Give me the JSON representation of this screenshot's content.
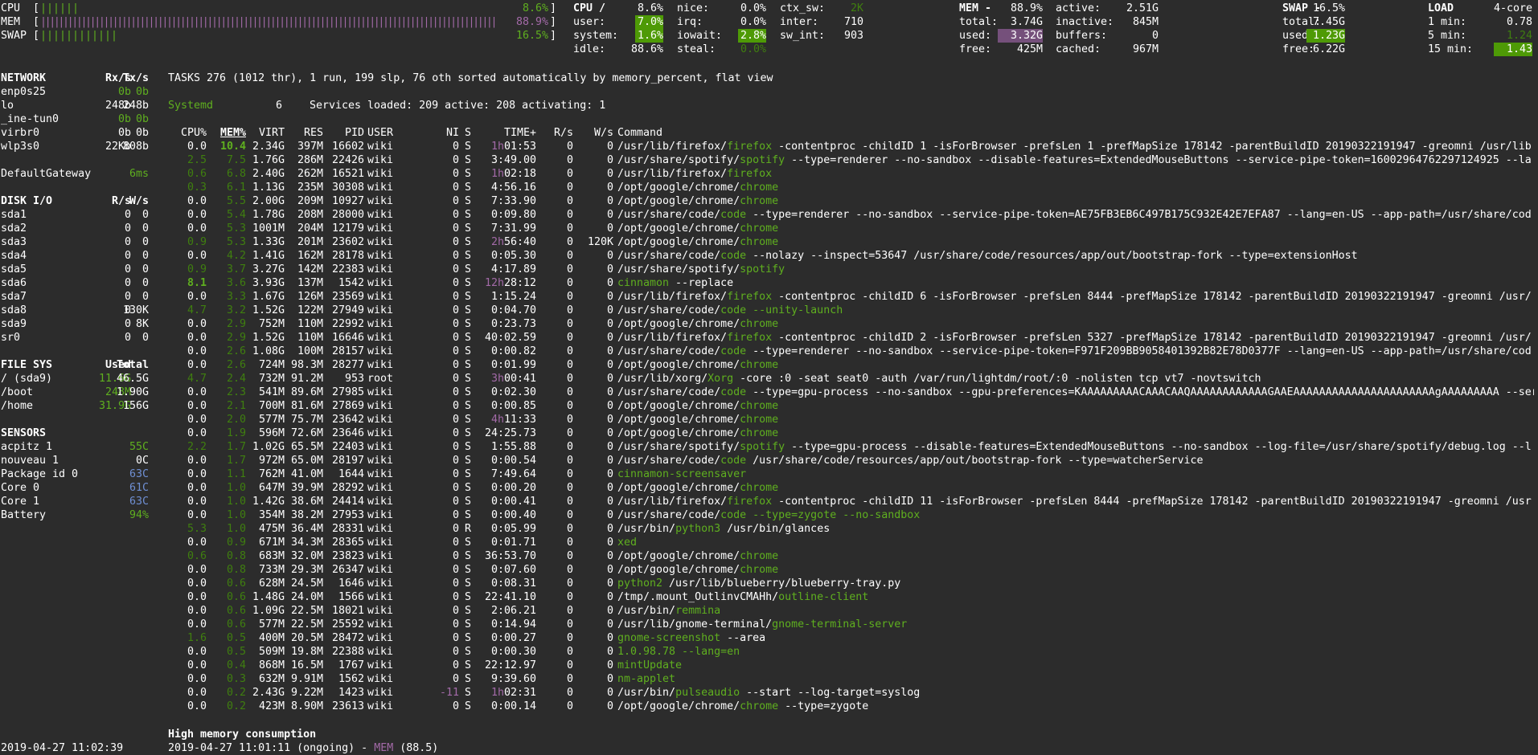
{
  "top": {
    "cpu_label": "CPU",
    "cpu_bar": "||||||",
    "cpu_pct": "8.6%",
    "mem_label": "MEM",
    "mem_bar": "|||||||||||||||||||||||||||||||||||||||||||||||||||||||||||||||||||||||||||||||||||||||||||||||||||||",
    "mem_pct": "88.9%",
    "swap_label": "SWAP",
    "swap_bar": "||||||||||||",
    "swap_pct": "16.5%",
    "cpu_block": {
      "title": "CPU /",
      "total": "8.6%",
      "rows": [
        [
          "user:",
          "7.0%"
        ],
        [
          "system:",
          "1.6%"
        ],
        [
          "idle:",
          "88.6%"
        ]
      ],
      "mid": [
        [
          "nice:",
          "0.0%"
        ],
        [
          "irq:",
          "0.0%"
        ],
        [
          "iowait:",
          "2.8%"
        ],
        [
          "steal:",
          "0.0%"
        ]
      ],
      "right": [
        [
          "ctx_sw:",
          "2K"
        ],
        [
          "inter:",
          "710"
        ],
        [
          "sw_int:",
          "903"
        ]
      ]
    },
    "mem_block": {
      "title": "MEM -",
      "pct": "88.9%",
      "rows": [
        [
          "total:",
          "3.74G"
        ],
        [
          "used:",
          "3.32G"
        ],
        [
          "free:",
          "425M"
        ]
      ],
      "right": [
        [
          "active:",
          "2.51G"
        ],
        [
          "inactive:",
          "845M"
        ],
        [
          "buffers:",
          "0"
        ],
        [
          "cached:",
          "967M"
        ]
      ]
    },
    "swap_block": {
      "title": "SWAP -",
      "pct": "16.5%",
      "rows": [
        [
          "total:",
          "7.45G"
        ],
        [
          "used:",
          "1.23G"
        ],
        [
          "free:",
          "6.22G"
        ]
      ]
    },
    "load_block": {
      "title": "LOAD",
      "cores": "4-core",
      "rows": [
        [
          "1 min:",
          "0.78"
        ],
        [
          "5 min:",
          "1.24"
        ],
        [
          "15 min:",
          "1.43"
        ]
      ]
    }
  },
  "network": {
    "header": [
      "NETWORK",
      "Rx/s",
      "Tx/s"
    ],
    "rows": [
      [
        "enp0s25",
        "0b",
        "0b"
      ],
      [
        "lo",
        "248b",
        "248b"
      ],
      [
        "_ine-tun0",
        "0b",
        "0b"
      ],
      [
        "virbr0",
        "0b",
        "0b"
      ],
      [
        "wlp3s0",
        "22Kb",
        "808b"
      ]
    ],
    "gateway": [
      "DefaultGateway",
      "6ms"
    ]
  },
  "disk": {
    "header": [
      "DISK I/O",
      "R/s",
      "W/s"
    ],
    "rows": [
      [
        "sda1",
        "0",
        "0"
      ],
      [
        "sda2",
        "0",
        "0"
      ],
      [
        "sda3",
        "0",
        "0"
      ],
      [
        "sda4",
        "0",
        "0"
      ],
      [
        "sda5",
        "0",
        "0"
      ],
      [
        "sda6",
        "0",
        "0"
      ],
      [
        "sda7",
        "0",
        "0"
      ],
      [
        "sda8",
        "0",
        "130K"
      ],
      [
        "sda9",
        "0",
        "8K"
      ],
      [
        "sr0",
        "0",
        "0"
      ]
    ]
  },
  "fs": {
    "header": [
      "FILE SYS",
      "Used",
      "Total"
    ],
    "rows": [
      [
        "/ (sda9)",
        "11.6G",
        "46.5G"
      ],
      [
        "/boot",
        "248M",
        "1.90G"
      ],
      [
        "/home",
        "31.9G",
        "156G"
      ]
    ]
  },
  "sensors": {
    "header": "SENSORS",
    "rows": [
      [
        "acpitz 1",
        "55C"
      ],
      [
        "nouveau 1",
        "0C"
      ],
      [
        "Package id 0",
        "63C"
      ],
      [
        "Core 0",
        "61C"
      ],
      [
        "Core 1",
        "63C"
      ],
      [
        "Battery",
        "94%"
      ]
    ]
  },
  "tasks_line": "TASKS 276 (1012 thr), 1 run, 199 slp, 76 oth sorted automatically by memory_percent, flat view",
  "systemd": {
    "label": "Systemd",
    "count": "6",
    "services": "Services loaded: 209 active: 208 activating: 1"
  },
  "proc_header": [
    "CPU%",
    "MEM%",
    "VIRT",
    "RES",
    "PID",
    "USER",
    "NI",
    "S",
    "TIME+",
    "R/s",
    "W/s",
    "Command"
  ],
  "processes": [
    [
      "0.0",
      "10.4",
      "2.34G",
      "397M",
      "16602",
      "wiki",
      "0",
      "S",
      "1h01:53",
      "0",
      "0",
      "/usr/lib/firefox/",
      "firefox",
      " -contentproc -childID 1 -isForBrowser -prefsLen 1 -prefMapSize 178142 -parentBuildID 20190322191947 -greomni /usr/lib"
    ],
    [
      "2.5",
      "7.5",
      "1.76G",
      "286M",
      "22426",
      "wiki",
      "0",
      "S",
      "3:49.00",
      "0",
      "0",
      "/usr/share/spotify/",
      "spotify",
      " --type=renderer --no-sandbox --disable-features=ExtendedMouseButtons --service-pipe-token=16002964762297124925 --la"
    ],
    [
      "0.6",
      "6.8",
      "2.40G",
      "262M",
      "16521",
      "wiki",
      "0",
      "S",
      "1h02:18",
      "0",
      "0",
      "/usr/lib/firefox/",
      "firefox",
      ""
    ],
    [
      "0.3",
      "6.1",
      "1.13G",
      "235M",
      "30308",
      "wiki",
      "0",
      "S",
      "4:56.16",
      "0",
      "0",
      "/opt/google/chrome/",
      "chrome",
      ""
    ],
    [
      "0.0",
      "5.5",
      "2.00G",
      "209M",
      "10927",
      "wiki",
      "0",
      "S",
      "7:33.90",
      "0",
      "0",
      "/opt/google/chrome/",
      "chrome",
      ""
    ],
    [
      "0.0",
      "5.4",
      "1.78G",
      "208M",
      "28000",
      "wiki",
      "0",
      "S",
      "0:09.80",
      "0",
      "0",
      "/usr/share/code/",
      "code",
      " --type=renderer --no-sandbox --service-pipe-token=AE75FB3EB6C497B175C932E42E7EFA87 --lang=en-US --app-path=/usr/share/cod"
    ],
    [
      "0.0",
      "5.3",
      "1001M",
      "204M",
      "12179",
      "wiki",
      "0",
      "S",
      "7:31.99",
      "0",
      "0",
      "/opt/google/chrome/",
      "chrome",
      ""
    ],
    [
      "0.9",
      "5.3",
      "1.33G",
      "201M",
      "23602",
      "wiki",
      "0",
      "S",
      "2h56:40",
      "0",
      "120K",
      "/opt/google/chrome/",
      "chrome",
      ""
    ],
    [
      "0.0",
      "4.2",
      "1.41G",
      "162M",
      "28178",
      "wiki",
      "0",
      "S",
      "0:05.30",
      "0",
      "0",
      "/usr/share/code/",
      "code",
      " --nolazy --inspect=53647 /usr/share/code/resources/app/out/bootstrap-fork --type=extensionHost"
    ],
    [
      "0.9",
      "3.7",
      "3.27G",
      "142M",
      "22383",
      "wiki",
      "0",
      "S",
      "4:17.89",
      "0",
      "0",
      "/usr/share/spotify/",
      "spotify",
      ""
    ],
    [
      "8.1",
      "3.6",
      "3.93G",
      "137M",
      "1542",
      "wiki",
      "0",
      "S",
      "12h28:12",
      "0",
      "0",
      "",
      "cinnamon",
      " --replace"
    ],
    [
      "0.0",
      "3.3",
      "1.67G",
      "126M",
      "23569",
      "wiki",
      "0",
      "S",
      "1:15.24",
      "0",
      "0",
      "/usr/lib/firefox/",
      "firefox",
      " -contentproc -childID 6 -isForBrowser -prefsLen 8444 -prefMapSize 178142 -parentBuildID 20190322191947 -greomni /usr/"
    ],
    [
      "4.7",
      "3.2",
      "1.52G",
      "122M",
      "27949",
      "wiki",
      "0",
      "S",
      "0:04.70",
      "0",
      "0",
      "/usr/share/code/",
      "code",
      " --unity-launch"
    ],
    [
      "0.0",
      "2.9",
      "752M",
      "110M",
      "22992",
      "wiki",
      "0",
      "S",
      "0:23.73",
      "0",
      "0",
      "/opt/google/chrome/",
      "chrome",
      ""
    ],
    [
      "0.0",
      "2.9",
      "1.52G",
      "110M",
      "16646",
      "wiki",
      "0",
      "S",
      "40:02.59",
      "0",
      "0",
      "/usr/lib/firefox/",
      "firefox",
      " -contentproc -childID 2 -isForBrowser -prefsLen 5327 -prefMapSize 178142 -parentBuildID 20190322191947 -greomni /usr/"
    ],
    [
      "0.0",
      "2.6",
      "1.08G",
      "100M",
      "28157",
      "wiki",
      "0",
      "S",
      "0:00.82",
      "0",
      "0",
      "/usr/share/code/",
      "code",
      " --type=renderer --no-sandbox --service-pipe-token=F971F209BB9058401392B82E78D0377F --lang=en-US --app-path=/usr/share/cod"
    ],
    [
      "0.0",
      "2.6",
      "724M",
      "98.3M",
      "28277",
      "wiki",
      "0",
      "S",
      "0:01.99",
      "0",
      "0",
      "/opt/google/chrome/",
      "chrome",
      ""
    ],
    [
      "4.7",
      "2.4",
      "732M",
      "91.2M",
      "953",
      "root",
      "0",
      "S",
      "3h00:41",
      "0",
      "0",
      "/usr/lib/xorg/",
      "Xorg",
      " -core :0 -seat seat0 -auth /var/run/lightdm/root/:0 -nolisten tcp vt7 -novtswitch"
    ],
    [
      "0.0",
      "2.3",
      "541M",
      "89.6M",
      "27985",
      "wiki",
      "0",
      "S",
      "0:02.30",
      "0",
      "0",
      "/usr/share/code/",
      "code",
      " --type=gpu-process --no-sandbox --gpu-preferences=KAAAAAAAAACAAACAAQAAAAAAAAAAAAGAAEAAAAAAAAAAAAAAAAAAAAAAgAAAAAAAAA --serv"
    ],
    [
      "0.0",
      "2.1",
      "700M",
      "81.6M",
      "27869",
      "wiki",
      "0",
      "S",
      "0:00.85",
      "0",
      "0",
      "/opt/google/chrome/",
      "chrome",
      ""
    ],
    [
      "0.0",
      "2.0",
      "577M",
      "75.7M",
      "23642",
      "wiki",
      "0",
      "S",
      "4h11:33",
      "0",
      "0",
      "/opt/google/chrome/",
      "chrome",
      ""
    ],
    [
      "0.0",
      "1.9",
      "596M",
      "72.6M",
      "23646",
      "wiki",
      "0",
      "S",
      "24:25.73",
      "0",
      "0",
      "/opt/google/chrome/",
      "chrome",
      ""
    ],
    [
      "2.2",
      "1.7",
      "1.02G",
      "65.5M",
      "22403",
      "wiki",
      "0",
      "S",
      "1:55.88",
      "0",
      "0",
      "/usr/share/spotify/",
      "spotify",
      " --type=gpu-process --disable-features=ExtendedMouseButtons --no-sandbox --log-file=/usr/share/spotify/debug.log --l"
    ],
    [
      "0.0",
      "1.7",
      "972M",
      "65.0M",
      "28197",
      "wiki",
      "0",
      "S",
      "0:00.54",
      "0",
      "0",
      "/usr/share/code/",
      "code",
      " /usr/share/code/resources/app/out/bootstrap-fork --type=watcherService"
    ],
    [
      "0.0",
      "1.1",
      "762M",
      "41.0M",
      "1644",
      "wiki",
      "0",
      "S",
      "7:49.64",
      "0",
      "0",
      "",
      "cinnamon-screensaver",
      ""
    ],
    [
      "0.0",
      "1.0",
      "647M",
      "39.9M",
      "28292",
      "wiki",
      "0",
      "S",
      "0:00.20",
      "0",
      "0",
      "/opt/google/chrome/",
      "chrome",
      ""
    ],
    [
      "0.0",
      "1.0",
      "1.42G",
      "38.6M",
      "24414",
      "wiki",
      "0",
      "S",
      "0:00.41",
      "0",
      "0",
      "/usr/lib/firefox/",
      "firefox",
      " -contentproc -childID 11 -isForBrowser -prefsLen 8444 -prefMapSize 178142 -parentBuildID 20190322191947 -greomni /usr"
    ],
    [
      "0.0",
      "1.0",
      "354M",
      "38.2M",
      "27953",
      "wiki",
      "0",
      "S",
      "0:00.40",
      "0",
      "0",
      "/usr/share/code/",
      "code",
      " --type=zygote --no-sandbox"
    ],
    [
      "5.3",
      "1.0",
      "475M",
      "36.4M",
      "28331",
      "wiki",
      "0",
      "R",
      "0:05.99",
      "0",
      "0",
      "/usr/bin/",
      "python3",
      " /usr/bin/glances"
    ],
    [
      "0.0",
      "0.9",
      "671M",
      "34.3M",
      "28365",
      "wiki",
      "0",
      "S",
      "0:01.71",
      "0",
      "0",
      "",
      "xed",
      ""
    ],
    [
      "0.6",
      "0.8",
      "683M",
      "32.0M",
      "23823",
      "wiki",
      "0",
      "S",
      "36:53.70",
      "0",
      "0",
      "/opt/google/chrome/",
      "chrome",
      ""
    ],
    [
      "0.0",
      "0.8",
      "733M",
      "29.3M",
      "26347",
      "wiki",
      "0",
      "S",
      "0:07.60",
      "0",
      "0",
      "/opt/google/chrome/",
      "chrome",
      ""
    ],
    [
      "0.0",
      "0.6",
      "628M",
      "24.5M",
      "1646",
      "wiki",
      "0",
      "S",
      "0:08.31",
      "0",
      "0",
      "",
      "python2",
      " /usr/lib/blueberry/blueberry-tray.py"
    ],
    [
      "0.0",
      "0.6",
      "1.48G",
      "24.0M",
      "1566",
      "wiki",
      "0",
      "S",
      "22:41.10",
      "0",
      "0",
      "/tmp/.mount_OutlinvCMAHh/",
      "outline-client",
      ""
    ],
    [
      "0.0",
      "0.6",
      "1.09G",
      "22.5M",
      "18021",
      "wiki",
      "0",
      "S",
      "2:06.21",
      "0",
      "0",
      "/usr/bin/",
      "remmina",
      ""
    ],
    [
      "0.0",
      "0.6",
      "577M",
      "22.5M",
      "25592",
      "wiki",
      "0",
      "S",
      "0:14.94",
      "0",
      "0",
      "/usr/lib/gnome-terminal/",
      "gnome-terminal-server",
      ""
    ],
    [
      "1.6",
      "0.5",
      "400M",
      "20.5M",
      "28472",
      "wiki",
      "0",
      "S",
      "0:00.27",
      "0",
      "0",
      "",
      "gnome-screenshot",
      " --area"
    ],
    [
      "0.0",
      "0.5",
      "509M",
      "19.8M",
      "22388",
      "wiki",
      "0",
      "S",
      "0:00.30",
      "0",
      "0",
      "",
      "1.0.98.78 --lang=en",
      ""
    ],
    [
      "0.0",
      "0.4",
      "868M",
      "16.5M",
      "1767",
      "wiki",
      "0",
      "S",
      "22:12.97",
      "0",
      "0",
      "",
      "mintUpdate",
      ""
    ],
    [
      "0.0",
      "0.3",
      "632M",
      "9.91M",
      "1562",
      "wiki",
      "0",
      "S",
      "9:39.60",
      "0",
      "0",
      "",
      "nm-applet",
      ""
    ],
    [
      "0.0",
      "0.2",
      "2.43G",
      "9.22M",
      "1423",
      "wiki",
      "-11",
      "S",
      "1h02:31",
      "0",
      "0",
      "/usr/bin/",
      "pulseaudio",
      " --start --log-target=syslog"
    ],
    [
      "0.0",
      "0.2",
      "423M",
      "8.90M",
      "23613",
      "wiki",
      "0",
      "S",
      "0:00.14",
      "0",
      "0",
      "/opt/google/chrome/",
      "chrome",
      " --type=zygote"
    ]
  ],
  "alert": {
    "title": "High memory consumption",
    "line_prefix": "2019-04-27 11:01:11 (ongoing) - ",
    "mem": "MEM",
    "value": " (88.5)"
  },
  "clock": "2019-04-27 11:02:39",
  "colors": {
    "green": "#5faf1f",
    "purple": "#a36aa8",
    "blue": "#6f8fd3",
    "bg": "#2c2c2c"
  }
}
